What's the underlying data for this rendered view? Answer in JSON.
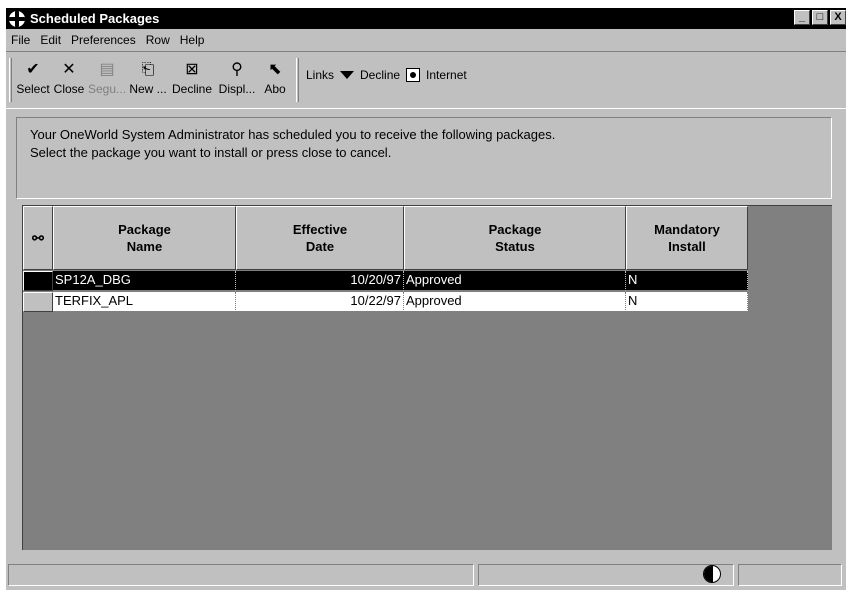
{
  "window": {
    "title": "Scheduled Packages",
    "controls": [
      "_",
      "□",
      "X"
    ]
  },
  "menu": {
    "items": [
      {
        "label": "File"
      },
      {
        "label": "Edit"
      },
      {
        "label": "Preferences"
      },
      {
        "label": "Row"
      },
      {
        "label": "Help"
      }
    ]
  },
  "toolbar": {
    "buttons": [
      {
        "label": "Select",
        "icon": "checkmark-icon",
        "glyph": "✔",
        "disabled": false
      },
      {
        "label": "Close",
        "icon": "close-x-icon",
        "glyph": "✕",
        "disabled": false
      },
      {
        "label": "Segu...",
        "icon": "document-icon",
        "glyph": "▤",
        "disabled": true
      },
      {
        "label": "New ...",
        "icon": "new-install-icon",
        "glyph": "⎗",
        "disabled": false
      },
      {
        "label": "Decline",
        "icon": "decline-icon",
        "glyph": "⊠",
        "disabled": false
      },
      {
        "label": "Displ...",
        "icon": "display-icon",
        "glyph": "⚲",
        "disabled": false
      },
      {
        "label": "Abo",
        "icon": "about-pointer-icon",
        "glyph": "⬉",
        "disabled": false
      }
    ],
    "links_label": "Links",
    "decline_link": "Decline",
    "internet_link": "Internet"
  },
  "message": {
    "line1": "Your OneWorld System Administrator has scheduled you to receive the following packages.",
    "line2": "Select the package you want to install or press close to cancel."
  },
  "grid": {
    "columns": [
      {
        "label": "Package\nName"
      },
      {
        "label": "Effective\nDate"
      },
      {
        "label": "Package\nStatus"
      },
      {
        "label": "Mandatory\nInstall"
      }
    ],
    "rows": [
      {
        "name": "SP12A_DBG",
        "date": "10/20/97",
        "status": "Approved",
        "mandatory": "N",
        "selected": true
      },
      {
        "name": "TERFIX_APL",
        "date": "10/22/97",
        "status": "Approved",
        "mandatory": "N",
        "selected": false
      }
    ]
  }
}
